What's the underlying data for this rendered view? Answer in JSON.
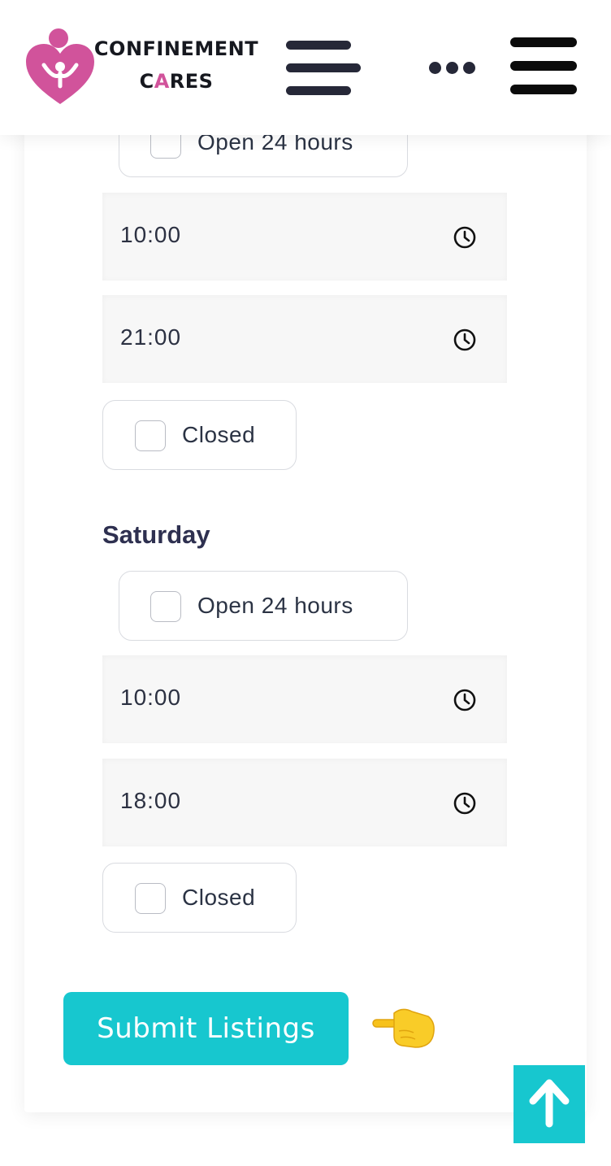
{
  "header": {
    "brand_line1": "CONFINEMENT",
    "brand_line2_a": "C",
    "brand_line2_b": "A",
    "brand_line2_c": "RES",
    "logo_icon": "mother-baby-heart-logo",
    "menu_icon": "hamburger-menu-icon",
    "more_icon": "more-dots-icon",
    "menu_icon_2": "hamburger-menu-icon"
  },
  "colors": {
    "brand_pink": "#d1539b",
    "accent_teal": "#17c7cf",
    "text_dark": "#2e3050"
  },
  "schedule": {
    "friday_partial": {
      "open24_label": "Open 24 hours",
      "open_time": "10:00",
      "close_time": "21:00",
      "closed_label": "Closed"
    },
    "saturday": {
      "day_label": "Saturday",
      "open24_label": "Open 24 hours",
      "open_time": "10:00",
      "close_time": "18:00",
      "closed_label": "Closed"
    }
  },
  "actions": {
    "submit_label": "Submit Listings",
    "pointer_icon": "backhand-index-pointing-right-icon",
    "back_to_top_icon": "arrow-up-icon"
  }
}
